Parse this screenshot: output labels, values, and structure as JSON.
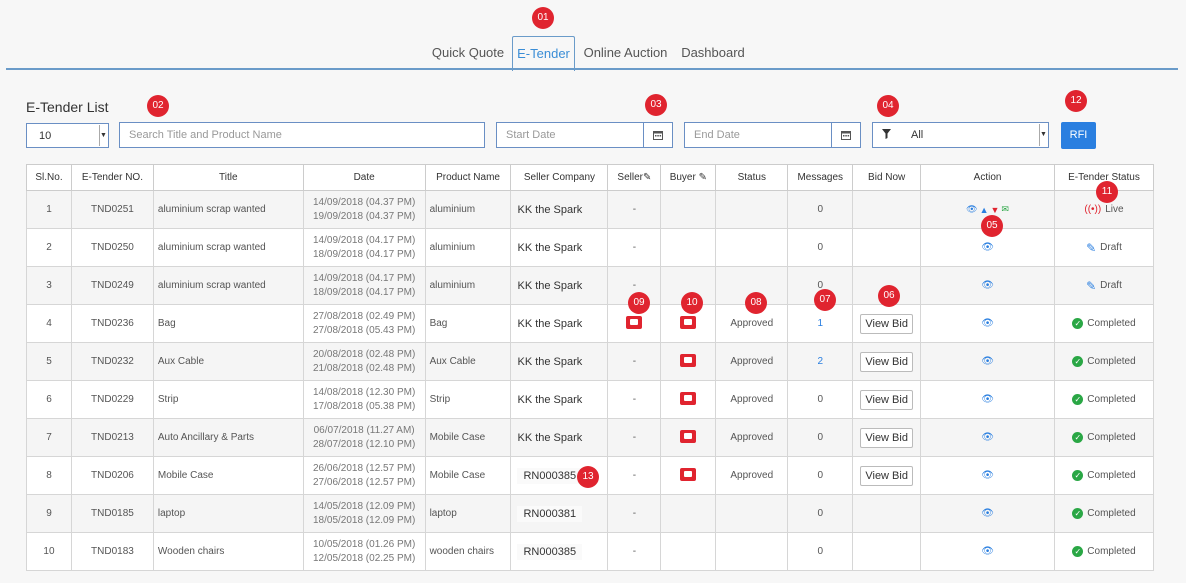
{
  "nav": {
    "tabs": [
      {
        "label": "Quick Quote",
        "active": false
      },
      {
        "label": "E-Tender",
        "active": true
      },
      {
        "label": "Online Auction",
        "active": false
      },
      {
        "label": "Dashboard",
        "active": false
      }
    ]
  },
  "badges": {
    "b01": "01",
    "b02": "02",
    "b03": "03",
    "b04": "04",
    "b05": "05",
    "b06": "06",
    "b07": "07",
    "b08": "08",
    "b09": "09",
    "b10": "10",
    "b11": "11",
    "b12": "12",
    "b13": "13"
  },
  "list": {
    "title": "E-Tender List"
  },
  "filters": {
    "page_size": "10",
    "search_placeholder": "Search Title and Product Name",
    "start_placeholder": "Start Date",
    "end_placeholder": "End Date",
    "status_filter": "All",
    "rfi_label": "RFI"
  },
  "table": {
    "headers": [
      "Sl.No.",
      "E-Tender NO.",
      "Title",
      "Date",
      "Product Name",
      "Seller Company",
      "Seller",
      "Buyer",
      "Status",
      "Messages",
      "Bid Now",
      "Action",
      "E-Tender Status"
    ],
    "rows": [
      {
        "sl": "1",
        "no": "TND0251",
        "title": "aluminium scrap wanted",
        "d1": "14/09/2018 (04.37 PM)",
        "d2": "19/09/2018 (04.37 PM)",
        "product": "aluminium",
        "company": "KK the Spark",
        "seller": "-",
        "buyer": "",
        "status": "",
        "messages": "0",
        "bid": "",
        "estatus": "Live"
      },
      {
        "sl": "2",
        "no": "TND0250",
        "title": "aluminium scrap wanted",
        "d1": "14/09/2018 (04.17 PM)",
        "d2": "18/09/2018 (04.17 PM)",
        "product": "aluminium",
        "company": "KK the Spark",
        "seller": "-",
        "buyer": "",
        "status": "",
        "messages": "0",
        "bid": "",
        "estatus": "Draft"
      },
      {
        "sl": "3",
        "no": "TND0249",
        "title": "aluminium scrap wanted",
        "d1": "14/09/2018 (04.17 PM)",
        "d2": "18/09/2018 (04.17 PM)",
        "product": "aluminium",
        "company": "KK the Spark",
        "seller": "-",
        "buyer": "",
        "status": "",
        "messages": "0",
        "bid": "",
        "estatus": "Draft"
      },
      {
        "sl": "4",
        "no": "TND0236",
        "title": "Bag",
        "d1": "27/08/2018 (02.49 PM)",
        "d2": "27/08/2018 (05.43 PM)",
        "product": "Bag",
        "company": "KK the Spark",
        "seller": "",
        "buyer": "",
        "status": "Approved",
        "messages": "1",
        "bid": "View Bid",
        "estatus": "Completed"
      },
      {
        "sl": "5",
        "no": "TND0232",
        "title": "Aux Cable",
        "d1": "20/08/2018 (02.48 PM)",
        "d2": "21/08/2018 (02.48 PM)",
        "product": "Aux Cable",
        "company": "KK the Spark",
        "seller": "-",
        "buyer": "",
        "status": "Approved",
        "messages": "2",
        "bid": "View Bid",
        "estatus": "Completed"
      },
      {
        "sl": "6",
        "no": "TND0229",
        "title": "Strip",
        "d1": "14/08/2018 (12.30 PM)",
        "d2": "17/08/2018 (05.38 PM)",
        "product": "Strip",
        "company": "KK the Spark",
        "seller": "-",
        "buyer": "",
        "status": "Approved",
        "messages": "0",
        "bid": "View Bid",
        "estatus": "Completed"
      },
      {
        "sl": "7",
        "no": "TND0213",
        "title": "Auto Ancillary & Parts",
        "d1": "06/07/2018 (11.27 AM)",
        "d2": "28/07/2018 (12.10 PM)",
        "product": "Mobile Case",
        "company": "KK the Spark",
        "seller": "-",
        "buyer": "",
        "status": "Approved",
        "messages": "0",
        "bid": "View Bid",
        "estatus": "Completed"
      },
      {
        "sl": "8",
        "no": "TND0206",
        "title": "Mobile Case",
        "d1": "26/06/2018 (12.57 PM)",
        "d2": "27/06/2018 (12.57 PM)",
        "product": "Mobile Case",
        "company": "RN000385",
        "seller": "-",
        "buyer": "",
        "status": "Approved",
        "messages": "0",
        "bid": "View Bid",
        "estatus": "Completed"
      },
      {
        "sl": "9",
        "no": "TND0185",
        "title": "laptop",
        "d1": "14/05/2018 (12.09 PM)",
        "d2": "18/05/2018 (12.09 PM)",
        "product": "laptop",
        "company": "RN000381",
        "seller": "-",
        "buyer": "",
        "status": "",
        "messages": "0",
        "bid": "",
        "estatus": "Completed"
      },
      {
        "sl": "10",
        "no": "TND0183",
        "title": "Wooden chairs",
        "d1": "10/05/2018 (01.26 PM)",
        "d2": "12/05/2018 (02.25 PM)",
        "product": "wooden chairs",
        "company": "RN000385",
        "seller": "-",
        "buyer": "",
        "status": "",
        "messages": "0",
        "bid": "",
        "estatus": "Completed"
      }
    ]
  },
  "colors": {
    "accent": "#2a7fe0",
    "badge": "#e0242f",
    "ok": "#2aa745"
  }
}
